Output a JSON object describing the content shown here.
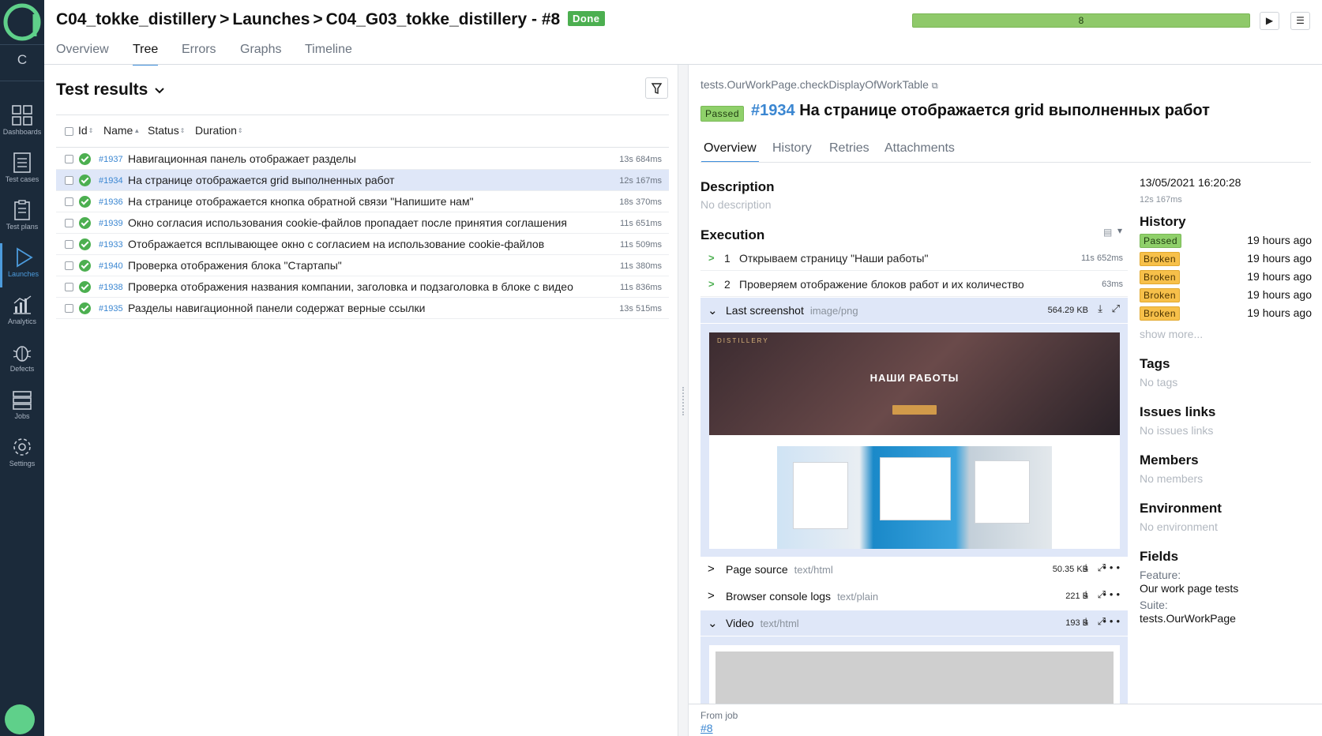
{
  "sidebar": {
    "collapse_label": "C",
    "items": [
      {
        "label": "Dashboards",
        "icon": "dashboards-icon"
      },
      {
        "label": "Test cases",
        "icon": "test-cases-icon"
      },
      {
        "label": "Test plans",
        "icon": "test-plans-icon"
      },
      {
        "label": "Launches",
        "icon": "launches-icon",
        "active": true
      },
      {
        "label": "Analytics",
        "icon": "analytics-icon"
      },
      {
        "label": "Defects",
        "icon": "bug-icon"
      },
      {
        "label": "Jobs",
        "icon": "jobs-icon"
      },
      {
        "label": "Settings",
        "icon": "gear-icon"
      }
    ]
  },
  "header": {
    "crumb_project": "C04_tokke_distillery",
    "crumb_section": "Launches",
    "crumb_launch": "C04_G03_tokke_distillery - #8",
    "status_badge": "Done",
    "progress_value": "8",
    "progress_fraction": 1.0,
    "play_icon": "▶",
    "menu_icon": "☰"
  },
  "tabs": [
    "Overview",
    "Tree",
    "Errors",
    "Graphs",
    "Timeline"
  ],
  "active_tab": "Tree",
  "test_results": {
    "title": "Test results",
    "columns": {
      "id": "Id",
      "name": "Name",
      "status": "Status",
      "duration": "Duration"
    },
    "rows": [
      {
        "id": "#1937",
        "name": "Навигационная панель отображает разделы",
        "duration": "13s 684ms"
      },
      {
        "id": "#1934",
        "name": "На странице отображается grid выполненных работ",
        "duration": "12s 167ms"
      },
      {
        "id": "#1936",
        "name": "На странице отображается кнопка обратной связи \"Напишите нам\"",
        "duration": "18s 370ms"
      },
      {
        "id": "#1939",
        "name": "Окно согласия использования cookie-файлов пропадает после принятия соглашения",
        "duration": "11s 651ms"
      },
      {
        "id": "#1933",
        "name": "Отображается всплывающее окно с согласием на использование cookie-файлов",
        "duration": "11s 509ms"
      },
      {
        "id": "#1940",
        "name": "Проверка отображения блока \"Стартапы\"",
        "duration": "11s 380ms"
      },
      {
        "id": "#1938",
        "name": "Проверка отображения названия компании, заголовка и подзаголовка в блоке с видео",
        "duration": "11s 836ms"
      },
      {
        "id": "#1935",
        "name": "Разделы навигационной панели содержат верные ссылки",
        "duration": "13s 515ms"
      }
    ]
  },
  "detail": {
    "path": "tests.OurWorkPage.checkDisplayOfWorkTable",
    "status": "Passed",
    "number": "#1934",
    "title": "На странице отображается grid выполненных работ",
    "tabs": [
      "Overview",
      "History",
      "Retries",
      "Attachments"
    ],
    "description_title": "Description",
    "description_value": "No description",
    "execution_title": "Execution",
    "steps": [
      {
        "n": "1",
        "text": "Открываем страницу \"Наши работы\"",
        "duration": "11s 652ms"
      },
      {
        "n": "2",
        "text": "Проверяем отображение блоков работ и их количество",
        "duration": "63ms"
      }
    ],
    "attachments": [
      {
        "name": "Last screenshot",
        "mime": "image/png",
        "size": "564.29 KB"
      },
      {
        "name": "Page source",
        "mime": "text/html",
        "size": "50.35 KB"
      },
      {
        "name": "Browser console logs",
        "mime": "text/plain",
        "size": "221 B"
      },
      {
        "name": "Video",
        "mime": "text/html",
        "size": "193 B"
      }
    ],
    "screenshot": {
      "brand": "DISTILLERY",
      "heading": "НАШИ РАБОТЫ"
    },
    "from_job_label": "From job",
    "from_job_link": "#8"
  },
  "side": {
    "date": "13/05/2021 16:20:28",
    "duration": "12s 167ms",
    "history_title": "History",
    "history": [
      {
        "status": "Passed",
        "time": "19 hours ago"
      },
      {
        "status": "Broken",
        "time": "19 hours ago"
      },
      {
        "status": "Broken",
        "time": "19 hours ago"
      },
      {
        "status": "Broken",
        "time": "19 hours ago"
      },
      {
        "status": "Broken",
        "time": "19 hours ago"
      }
    ],
    "show_more": "show more...",
    "tags_title": "Tags",
    "tags_value": "No tags",
    "issues_title": "Issues links",
    "issues_value": "No issues links",
    "members_title": "Members",
    "members_value": "No members",
    "env_title": "Environment",
    "env_value": "No environment",
    "fields_title": "Fields",
    "field1_key": "Feature:",
    "field1_value": "Our work page tests",
    "field2_key": "Suite:",
    "field2_value": "tests.OurWorkPage"
  },
  "colors": {
    "sidebar_bg": "#1b2a3a",
    "accent": "#3a86d1",
    "passed": "#8fd06a",
    "broken": "#f7c04a",
    "done": "#4caf50"
  }
}
